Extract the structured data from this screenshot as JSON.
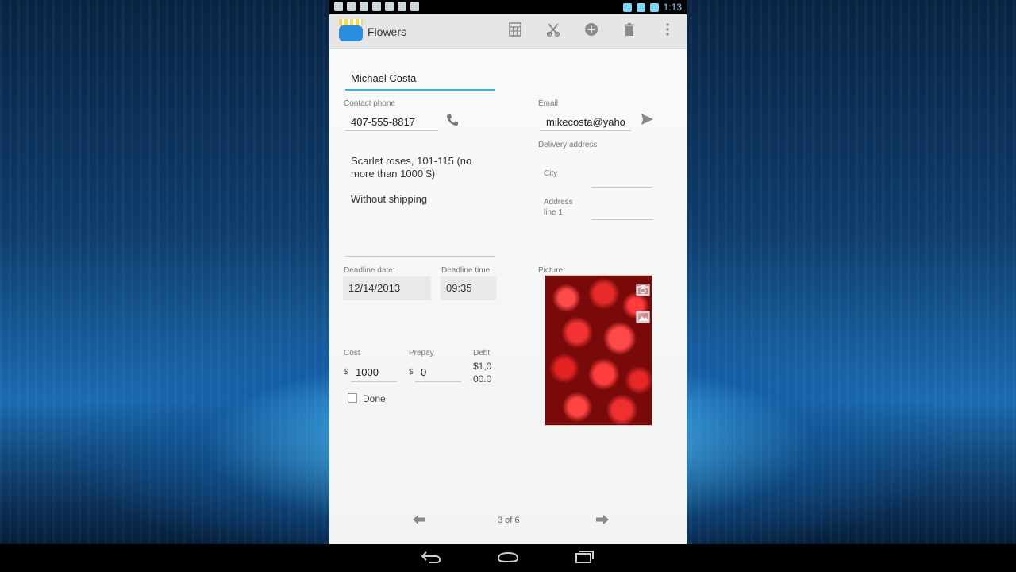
{
  "status_bar": {
    "time": "1:13"
  },
  "action_bar": {
    "title": "Flowers",
    "buttons": [
      "calculator-icon",
      "cut-icon",
      "add-icon",
      "delete-icon",
      "overflow-menu-icon"
    ]
  },
  "form": {
    "customer_name": "Michael  Costa",
    "contact_phone": {
      "label": "Contact phone",
      "value": "407-555-8817"
    },
    "email": {
      "label": "Email",
      "value": "mikecosta@yaho"
    },
    "delivery_address": {
      "label": "Delivery address",
      "city_label": "City",
      "address_label": "Address line 1"
    },
    "description": "Scarlet roses, 101-115 (no more than 1000 $)",
    "shipping": "Without shipping",
    "deadline_date": {
      "label": "Deadline date:",
      "value": "12/14/2013"
    },
    "deadline_time": {
      "label": "Deadline time:",
      "value": "09:35"
    },
    "picture_label": "Picture",
    "cost": {
      "label": "Cost",
      "currency": "$",
      "value": "1000"
    },
    "prepay": {
      "label": "Prepay",
      "currency": "$",
      "value": "0"
    },
    "debt": {
      "label": "Debt",
      "value_line1": "$1,0",
      "value_line2": "00.0"
    },
    "done_label": "Done"
  },
  "pager": {
    "text": "3 of 6"
  },
  "icons": {
    "phone": "phone-icon",
    "send": "send-icon",
    "camera": "camera-icon",
    "gallery": "gallery-icon",
    "prev": "arrow-left-icon",
    "next": "arrow-right-icon"
  },
  "colors": {
    "accent": "#33b5e5",
    "rose": "#d61f1f"
  }
}
